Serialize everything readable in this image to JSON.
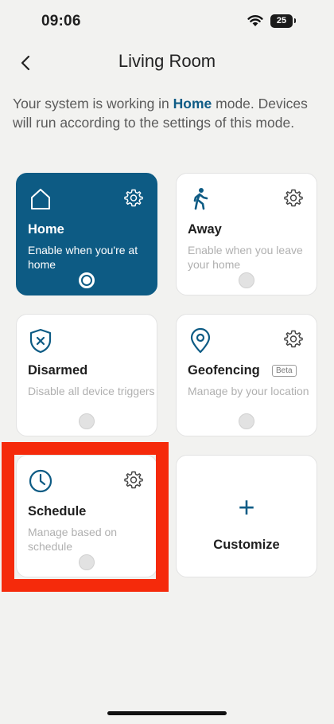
{
  "status_bar": {
    "time": "09:06",
    "battery": "25"
  },
  "header": {
    "title": "Living Room"
  },
  "description": {
    "prefix": "Your system is working in ",
    "mode": "Home",
    "suffix": " mode. Devices will run according to the settings of this mode."
  },
  "modes": [
    {
      "title": "Home",
      "description": "Enable when you're at home",
      "selected": true
    },
    {
      "title": "Away",
      "description": "Enable when you leave your home",
      "selected": false
    },
    {
      "title": "Disarmed",
      "description": "Disable all device triggers",
      "selected": false
    },
    {
      "title": "Geofencing",
      "badge": "Beta",
      "description": "Manage by your location",
      "selected": false
    },
    {
      "title": "Schedule",
      "description": "Manage based on schedule",
      "selected": false
    }
  ],
  "customize": {
    "icon": "+",
    "label": "Customize"
  },
  "colors": {
    "accent": "#0d5b84",
    "highlight": "#f52a0b"
  }
}
